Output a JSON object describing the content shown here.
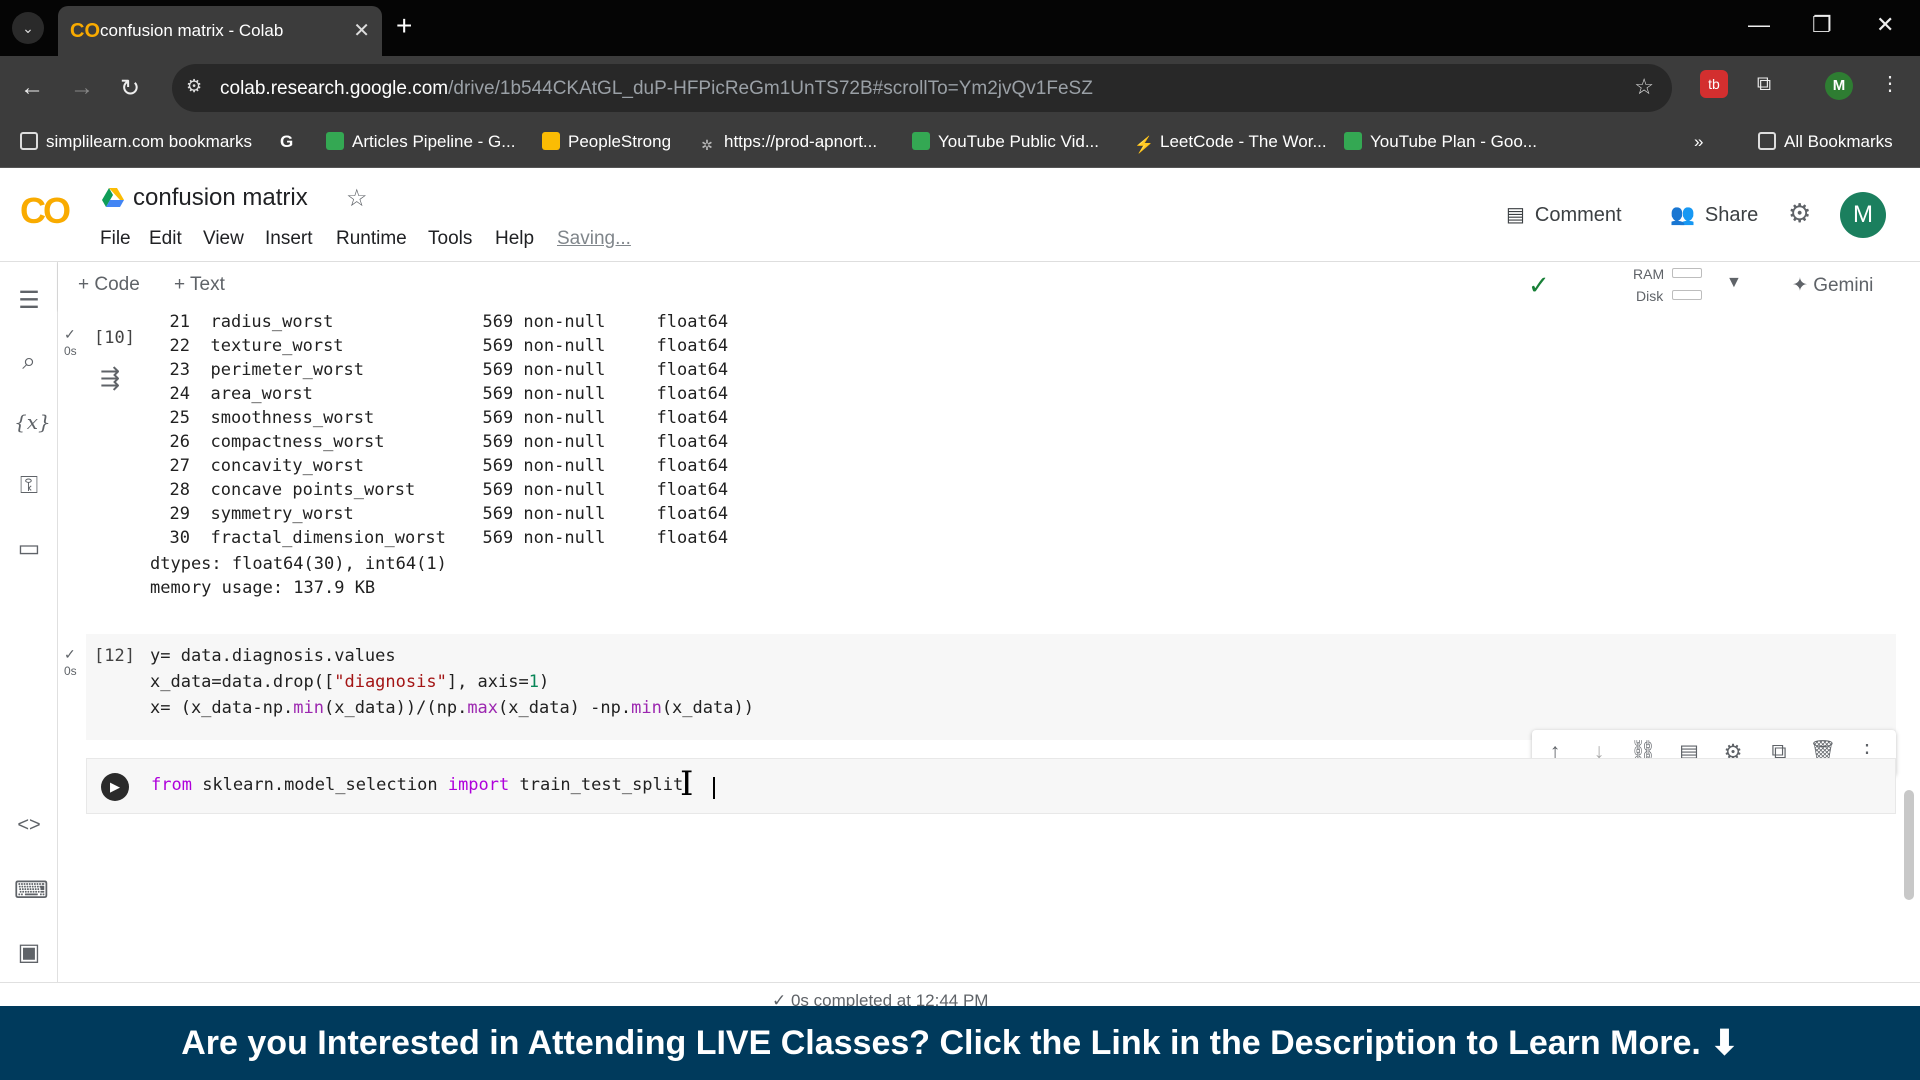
{
  "browser": {
    "tab_title": "confusion matrix - Colab",
    "tab_logo": "CO",
    "url_domain": "colab.research.google.com",
    "url_path": "/drive/1b544CKAtGL_duP-HFPicReGm1UnTS72B#scrollTo=Ym2jvQv1FeSZ",
    "profile_initial": "M",
    "bookmarks": [
      "simplilearn.com bookmarks",
      "Articles Pipeline - G...",
      "PeopleStrong",
      "https://prod-apnort...",
      "YouTube Public Vid...",
      "LeetCode - The Wor...",
      "YouTube Plan - Goo..."
    ],
    "all_bookmarks": "All Bookmarks",
    "more_bookmarks": "»"
  },
  "colab": {
    "logo": "CO",
    "notebook_title": "confusion matrix",
    "menu": [
      "File",
      "Edit",
      "View",
      "Insert",
      "Runtime",
      "Tools",
      "Help"
    ],
    "saving_label": "Saving...",
    "comment_label": "Comment",
    "share_label": "Share",
    "avatar_initial": "M"
  },
  "toolbar": {
    "add_code": "+ Code",
    "add_text": "+ Text",
    "ram_label": "RAM",
    "disk_label": "Disk",
    "gemini_label": "✦ Gemini"
  },
  "output_cell": {
    "exec_count": "[10]",
    "exec_time": "0s",
    "rows": [
      {
        "idx": "21",
        "name": "radius_worst",
        "count": "569 non-null",
        "dtype": "float64"
      },
      {
        "idx": "22",
        "name": "texture_worst",
        "count": "569 non-null",
        "dtype": "float64"
      },
      {
        "idx": "23",
        "name": "perimeter_worst",
        "count": "569 non-null",
        "dtype": "float64"
      },
      {
        "idx": "24",
        "name": "area_worst",
        "count": "569 non-null",
        "dtype": "float64"
      },
      {
        "idx": "25",
        "name": "smoothness_worst",
        "count": "569 non-null",
        "dtype": "float64"
      },
      {
        "idx": "26",
        "name": "compactness_worst",
        "count": "569 non-null",
        "dtype": "float64"
      },
      {
        "idx": "27",
        "name": "concavity_worst",
        "count": "569 non-null",
        "dtype": "float64"
      },
      {
        "idx": "28",
        "name": "concave points_worst",
        "count": "569 non-null",
        "dtype": "float64"
      },
      {
        "idx": "29",
        "name": "symmetry_worst",
        "count": "569 non-null",
        "dtype": "float64"
      },
      {
        "idx": "30",
        "name": "fractal_dimension_worst",
        "count": "569 non-null",
        "dtype": "float64"
      }
    ],
    "dtypes_line": "dtypes: float64(30), int64(1)",
    "memory_line": "memory usage: 137.9 KB"
  },
  "cell12": {
    "exec_count": "[12]",
    "exec_time": "0s",
    "line1": "y= data.diagnosis.values",
    "line2_a": "x_data=data.drop([",
    "line2_str": "\"diagnosis\"",
    "line2_b": "], axis=",
    "line2_num": "1",
    "line2_c": ")",
    "line3_a": "x= (x_data-np.",
    "line3_fn1": "min",
    "line3_b": "(x_data))/(np.",
    "line3_fn2": "max",
    "line3_c": "(x_data) -np.",
    "line3_fn3": "min",
    "line3_d": "(x_data))"
  },
  "active_cell": {
    "kw_from": "from",
    "module": " sklearn.model_selection ",
    "kw_import": "import",
    "name": " train_test_split"
  },
  "status": {
    "text": "✓  0s    completed at 12:44 PM"
  },
  "banner": {
    "text": "Are you Interested in Attending LIVE Classes? Click the Link in the Description to Learn More. ⬇"
  },
  "colors": {
    "colab_orange": "#f9ab00",
    "banner_bg": "#003a5c",
    "check_green": "#188038",
    "keyword_purple": "#af00db"
  }
}
